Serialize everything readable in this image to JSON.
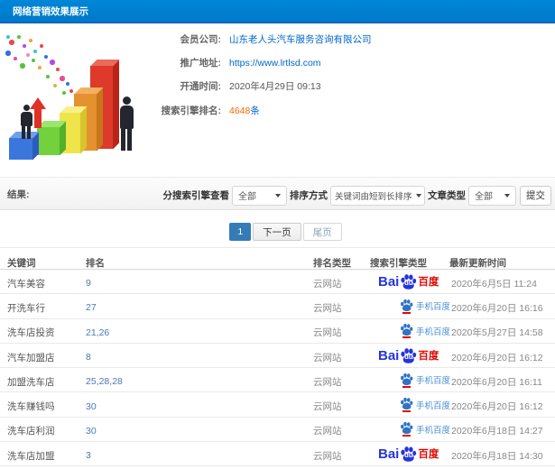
{
  "header": {
    "title": "网络营销效果展示"
  },
  "info": {
    "member_label": "会员公司:",
    "member_value": "山东老人头汽车服务咨询有限公司",
    "url_label": "推广地址:",
    "url_value": "https://www.lrtlsd.com",
    "open_label": "开通时间:",
    "open_value": "2020年4月29日 09:13",
    "rank_label": "搜索引擎排名:",
    "rank_value": "4648",
    "rank_suffix": "条"
  },
  "filters": {
    "result_label": "结果:",
    "engine_label": "分搜索引擎查看",
    "engine_value": "全部",
    "sort_label": "排序方式",
    "sort_value": "关键词由短到长排序",
    "article_label": "文章类型",
    "article_value": "全部",
    "submit_label": "提交"
  },
  "pagination": {
    "current": "1",
    "next": "下一页",
    "last": "尾页"
  },
  "engine_labels": {
    "baidu_prefix": "Bai",
    "baidu_du": "du",
    "baidu_suffix": "百度",
    "mobile": "手机百度"
  },
  "table": {
    "headers": [
      "关键词",
      "排名",
      "排名类型",
      "搜索引擎类型",
      "最新更新时间"
    ],
    "rows": [
      {
        "keyword": "汽车美容",
        "rank": "9",
        "rank_type": "云网站",
        "engine": "baidu",
        "updated": "2020年6月5日 11:24"
      },
      {
        "keyword": "开洗车行",
        "rank": "27",
        "rank_type": "云网站",
        "engine": "mobile-baidu",
        "updated": "2020年6月20日 16:16"
      },
      {
        "keyword": "洗车店投资",
        "rank": "21,26",
        "rank_type": "云网站",
        "engine": "mobile-baidu",
        "updated": "2020年5月27日 14:58"
      },
      {
        "keyword": "汽车加盟店",
        "rank": "8",
        "rank_type": "云网站",
        "engine": "baidu",
        "updated": "2020年6月20日 16:12"
      },
      {
        "keyword": "加盟洗车店",
        "rank": "25,28,28",
        "rank_type": "云网站",
        "engine": "mobile-baidu",
        "updated": "2020年6月20日 16:11"
      },
      {
        "keyword": "洗车赚钱吗",
        "rank": "30",
        "rank_type": "云网站",
        "engine": "mobile-baidu",
        "updated": "2020年6月20日 16:12"
      },
      {
        "keyword": "洗车店利润",
        "rank": "30",
        "rank_type": "云网站",
        "engine": "mobile-baidu",
        "updated": "2020年6月18日 14:27"
      },
      {
        "keyword": "洗车店加盟",
        "rank": "3",
        "rank_type": "云网站",
        "engine": "baidu",
        "updated": "2020年6月18日 14:30"
      }
    ]
  }
}
